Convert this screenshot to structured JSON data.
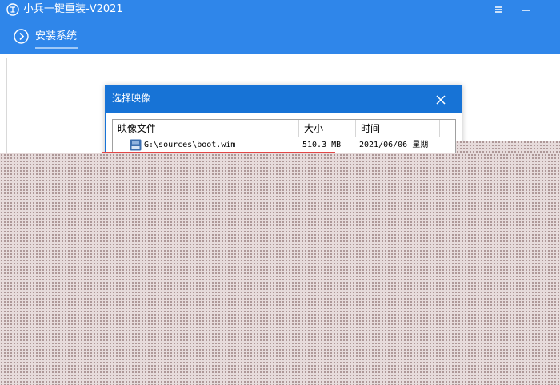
{
  "app": {
    "title": "小兵一键重装-V2021",
    "logo_icon": "app-logo-icon"
  },
  "window_controls": [
    {
      "name": "menu-icon",
      "symbol": "menu"
    },
    {
      "name": "minimize-icon",
      "symbol": "minimize"
    }
  ],
  "toolbar": {
    "back_icon": "chevron-right-circle-icon",
    "tab_label": "安装系统"
  },
  "dialog": {
    "title": "选择映像",
    "close_icon": "close-icon",
    "columns": [
      "映像文件",
      "大小",
      "时间"
    ],
    "rows": [
      {
        "checked": false,
        "icon": "disk-image-icon",
        "file": "G:\\sources\\boot.wim",
        "size": "510.3 MB",
        "time": "2021/06/06 星期"
      }
    ]
  },
  "colors": {
    "titlebar": "#2f86ea",
    "dialog_header": "#1773d6",
    "overlay": "#e7dcdc"
  }
}
